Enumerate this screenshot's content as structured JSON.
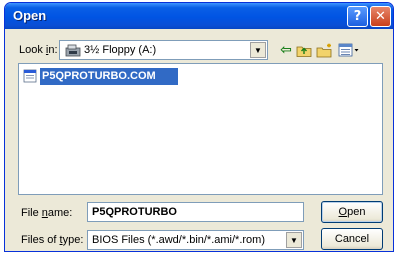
{
  "window": {
    "title": "Open",
    "help_glyph": "?",
    "close_glyph": "✕"
  },
  "lookin": {
    "label_pre": "Look ",
    "label_key": "i",
    "label_post": "n:",
    "value": "3½ Floppy (A:)",
    "icon": "floppy-icon"
  },
  "toolbar": {
    "back_icon": "back-arrow-icon",
    "up_icon": "up-folder-icon",
    "new_folder_icon": "new-folder-icon",
    "views_icon": "views-menu-icon"
  },
  "files": [
    {
      "name": "P5QPROTURBO.COM",
      "icon": "file-icon",
      "selected": true
    }
  ],
  "filename": {
    "label_pre": "File ",
    "label_key": "n",
    "label_post": "ame:",
    "value": "P5QPROTURBO"
  },
  "filetype": {
    "label_pre": "Files of ",
    "label_key": "t",
    "label_post": "ype:",
    "value": "BIOS Files (*.awd/*.bin/*.ami/*.rom)"
  },
  "buttons": {
    "open_key": "O",
    "open_rest": "pen",
    "cancel": "Cancel"
  },
  "colors": {
    "titlebar": "#0054e3",
    "selection": "#316ac5",
    "dialog_bg": "#ece9d8"
  }
}
